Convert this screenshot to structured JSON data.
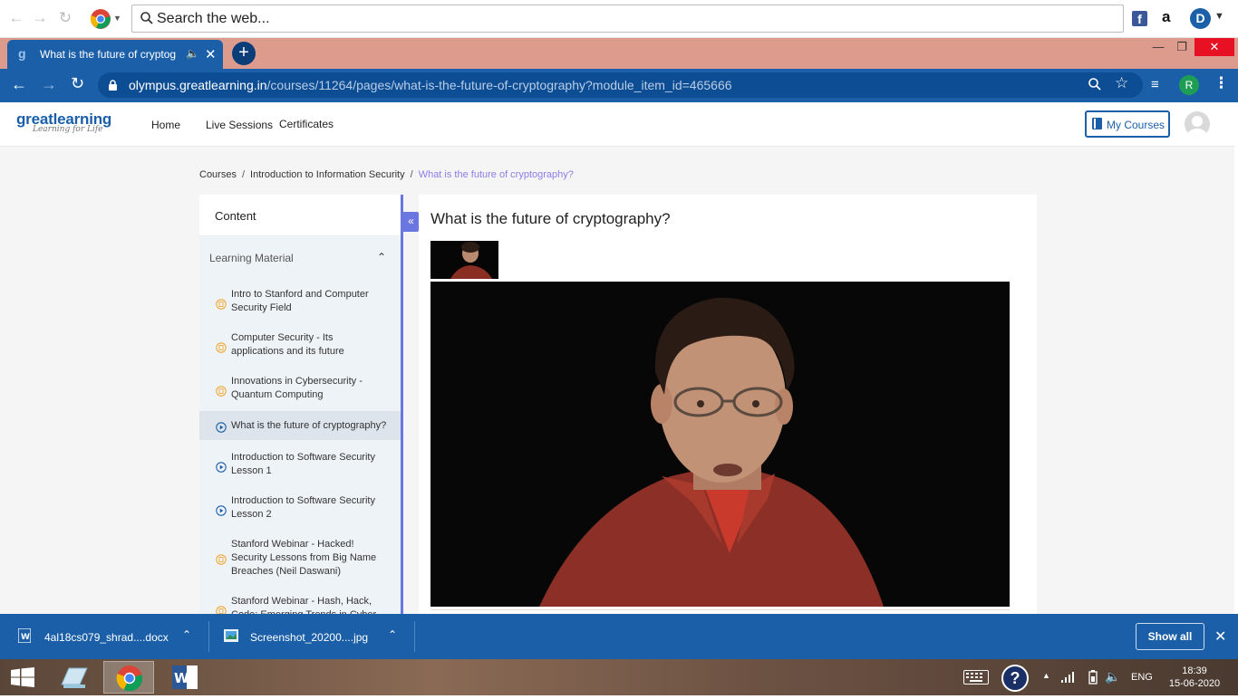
{
  "top_search": {
    "placeholder": "Search the web..."
  },
  "tab": {
    "title": "What is the future of cryptog"
  },
  "address": {
    "host": "olympus.greatlearning.in",
    "path": "/courses/11264/pages/what-is-the-future-of-cryptography?module_item_id=465666"
  },
  "profile_initial": "R",
  "ext_letter": "D",
  "site": {
    "logo": "greatlearning",
    "tagline": "Learning for Life",
    "nav": [
      "Home",
      "Live Sessions",
      "Certificates"
    ],
    "my_courses": "My Courses"
  },
  "breadcrumb": {
    "items": [
      "Courses",
      "Introduction to Information Security"
    ],
    "current": "What is the future of cryptography?",
    "separator": "/"
  },
  "sidebar": {
    "content_label": "Content",
    "section_label": "Learning Material",
    "items": [
      {
        "label": "Intro to Stanford and Computer Security Field",
        "icon": "document-icon"
      },
      {
        "label": "Computer Security - Its applications and its future",
        "icon": "document-icon"
      },
      {
        "label": "Innovations in Cybersecurity - Quantum Computing",
        "icon": "document-icon"
      },
      {
        "label": "What is the future of cryptography?",
        "icon": "play-icon",
        "active": true
      },
      {
        "label": "Introduction to Software Security Lesson 1",
        "icon": "play-icon"
      },
      {
        "label": "Introduction to Software Security Lesson 2",
        "icon": "play-icon"
      },
      {
        "label": "Stanford Webinar - Hacked! Security Lessons from Big Name Breaches (Neil Daswani)",
        "icon": "document-icon"
      },
      {
        "label": "Stanford Webinar - Hash, Hack, Code: Emerging Trends in Cyber",
        "icon": "document-icon"
      }
    ]
  },
  "main": {
    "title": "What is the future of cryptography?"
  },
  "downloads": {
    "items": [
      "4al18cs079_shrad....docx",
      "Screenshot_20200....jpg"
    ],
    "show_all": "Show all"
  },
  "taskbar": {
    "lang": "ENG",
    "time": "18:39",
    "date": "15-06-2020"
  },
  "colors": {
    "accent": "#1a5fa8",
    "tab_strip": "#dd9b8d",
    "sidebar_accent": "#6b77e0",
    "doc_icon": "#f0a830",
    "play_icon": "#1a5fa8"
  }
}
